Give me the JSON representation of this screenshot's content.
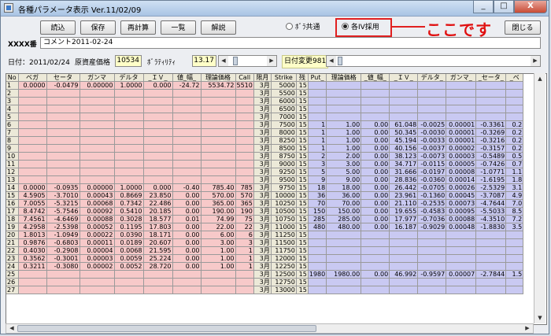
{
  "window": {
    "title": "各種パラメータ表示 Ver.11/02/09",
    "minimize": "_",
    "maximize": "□",
    "close": "X"
  },
  "toolbar": {
    "load": "読込",
    "save": "保存",
    "recalc": "再計算",
    "list": "一覧",
    "explain": "解説",
    "close": "閉じる"
  },
  "iv_mode": {
    "common_label": "ﾎﾞﾗ共通",
    "each_label": "各IV採用",
    "selected": "each"
  },
  "annotation": {
    "text": "ここです",
    "color": "#e01010"
  },
  "info": {
    "code": "XXXX番",
    "comment": "コメント2011-02-24"
  },
  "params": {
    "date_label": "日付：2011/02/24",
    "price_label": "原資産価格",
    "price_value": "10534",
    "vol_label": "ﾎﾞﾗﾃｨﾘﾃｨ",
    "vol_value": "13.17",
    "date_change_label": "日付変更981"
  },
  "colors": {
    "call_side": "#f7c9c9",
    "put_side": "#c9c9f2",
    "header": "#ece9d8",
    "yellow_field": "#ffffc8"
  },
  "grid": {
    "headers": [
      "No",
      "ベガ",
      "セータ",
      "ガンマ",
      "デルタ",
      "_ＩＶ_",
      "値_幅_",
      "理論価格",
      "Call",
      "限月",
      "Strike",
      "残",
      "Put_",
      "理論価格",
      "_値_幅_",
      "_ＩＶ_",
      "デルタ_",
      "ガンマ_",
      "_セータ_",
      "_ベ"
    ],
    "rows": [
      [
        "1",
        "0.0000",
        "-0.0479",
        "0.00000",
        "1.0000",
        "0.000",
        "-24.72",
        "5534.72",
        "5510",
        "3月",
        "5000",
        "15",
        "",
        "",
        "",
        "",
        "",
        "",
        "",
        ""
      ],
      [
        "2",
        "",
        "",
        "",
        "",
        "",
        "",
        "",
        "",
        "3月",
        "5500",
        "15",
        "",
        "",
        "",
        "",
        "",
        "",
        "",
        ""
      ],
      [
        "3",
        "",
        "",
        "",
        "",
        "",
        "",
        "",
        "",
        "3月",
        "6000",
        "15",
        "",
        "",
        "",
        "",
        "",
        "",
        "",
        ""
      ],
      [
        "4",
        "",
        "",
        "",
        "",
        "",
        "",
        "",
        "",
        "3月",
        "6500",
        "15",
        "",
        "",
        "",
        "",
        "",
        "",
        "",
        ""
      ],
      [
        "5",
        "",
        "",
        "",
        "",
        "",
        "",
        "",
        "",
        "3月",
        "7000",
        "15",
        "",
        "",
        "",
        "",
        "",
        "",
        "",
        ""
      ],
      [
        "6",
        "",
        "",
        "",
        "",
        "",
        "",
        "",
        "",
        "3月",
        "7500",
        "15",
        "1",
        "1.00",
        "0.00",
        "61.048",
        "-0.0025",
        "0.00001",
        "-0.3361",
        "0.2"
      ],
      [
        "7",
        "",
        "",
        "",
        "",
        "",
        "",
        "",
        "",
        "3月",
        "8000",
        "15",
        "1",
        "1.00",
        "0.00",
        "50.345",
        "-0.0030",
        "0.00001",
        "-0.3269",
        "0.2"
      ],
      [
        "8",
        "",
        "",
        "",
        "",
        "",
        "",
        "",
        "",
        "3月",
        "8250",
        "15",
        "1",
        "1.00",
        "0.00",
        "45.194",
        "-0.0033",
        "0.00001",
        "-0.3216",
        "0.2"
      ],
      [
        "9",
        "",
        "",
        "",
        "",
        "",
        "",
        "",
        "",
        "3月",
        "8500",
        "15",
        "1",
        "1.00",
        "0.00",
        "40.156",
        "-0.0037",
        "0.00002",
        "-0.3157",
        "0.2"
      ],
      [
        "10",
        "",
        "",
        "",
        "",
        "",
        "",
        "",
        "",
        "3月",
        "8750",
        "15",
        "2",
        "2.00",
        "0.00",
        "38.123",
        "-0.0073",
        "0.00003",
        "-0.5489",
        "0.5"
      ],
      [
        "11",
        "",
        "",
        "",
        "",
        "",
        "",
        "",
        "",
        "3月",
        "9000",
        "15",
        "3",
        "3.00",
        "0.00",
        "34.717",
        "-0.0115",
        "0.00005",
        "-0.7426",
        "0.7"
      ],
      [
        "12",
        "",
        "",
        "",
        "",
        "",
        "",
        "",
        "",
        "3月",
        "9250",
        "15",
        "5",
        "5.00",
        "0.00",
        "31.666",
        "-0.0197",
        "0.00008",
        "-1.0771",
        "1.1"
      ],
      [
        "13",
        "",
        "",
        "",
        "",
        "",
        "",
        "",
        "",
        "3月",
        "9500",
        "15",
        "9",
        "9.00",
        "0.00",
        "28.836",
        "-0.0360",
        "0.00014",
        "-1.6195",
        "1.8"
      ],
      [
        "14",
        "0.0000",
        "-0.0935",
        "0.00000",
        "1.0000",
        "0.000",
        "-0.40",
        "785.40",
        "785",
        "3月",
        "9750",
        "15",
        "18",
        "18.00",
        "0.00",
        "26.442",
        "-0.0705",
        "0.00026",
        "-2.5329",
        "3.1"
      ],
      [
        "15",
        "4.5905",
        "-3.7010",
        "0.00043",
        "0.8669",
        "23.850",
        "0.00",
        "570.00",
        "570",
        "3月",
        "10000",
        "15",
        "36",
        "36.00",
        "0.00",
        "23.961",
        "-0.1360",
        "0.00045",
        "-3.7087",
        "4.9"
      ],
      [
        "16",
        "7.0055",
        "-5.3215",
        "0.00068",
        "0.7342",
        "22.486",
        "0.00",
        "365.00",
        "365",
        "3月",
        "10250",
        "15",
        "70",
        "70.00",
        "0.00",
        "21.110",
        "-0.2535",
        "0.00073",
        "-4.7644",
        "7.0"
      ],
      [
        "17",
        "8.4742",
        "-5.7546",
        "0.00092",
        "0.5410",
        "20.185",
        "0.00",
        "190.00",
        "190",
        "3月",
        "10500",
        "15",
        "150",
        "150.00",
        "0.00",
        "19.655",
        "-0.4583",
        "0.00095",
        "-5.5033",
        "8.5"
      ],
      [
        "18",
        "7.4561",
        "-4.6469",
        "0.00088",
        "0.3028",
        "18.577",
        "0.01",
        "74.99",
        "75",
        "3月",
        "10750",
        "15",
        "285",
        "285.00",
        "0.00",
        "17.977",
        "-0.7036",
        "0.00088",
        "-4.3510",
        "7.2"
      ],
      [
        "19",
        "4.2958",
        "-2.5398",
        "0.00052",
        "0.1195",
        "17.803",
        "0.00",
        "22.00",
        "22",
        "3月",
        "11000",
        "15",
        "480",
        "480.00",
        "0.00",
        "16.187",
        "-0.9029",
        "0.00048",
        "-1.8830",
        "3.5"
      ],
      [
        "20",
        "1.8013",
        "-1.0949",
        "0.00022",
        "0.0390",
        "18.171",
        "0.00",
        "6.00",
        "6",
        "3月",
        "11250",
        "15",
        "",
        "",
        "",
        "",
        "",
        "",
        "",
        ""
      ],
      [
        "21",
        "0.9876",
        "-0.6803",
        "0.00011",
        "0.0189",
        "20.607",
        "0.00",
        "3.00",
        "3",
        "3月",
        "11500",
        "15",
        "",
        "",
        "",
        "",
        "",
        "",
        "",
        ""
      ],
      [
        "22",
        "0.4030",
        "-0.2908",
        "0.00004",
        "0.0068",
        "21.595",
        "0.00",
        "1.00",
        "1",
        "3月",
        "11750",
        "15",
        "",
        "",
        "",
        "",
        "",
        "",
        "",
        ""
      ],
      [
        "23",
        "0.3562",
        "-0.3001",
        "0.00003",
        "0.0059",
        "25.224",
        "0.00",
        "1.00",
        "1",
        "3月",
        "12000",
        "15",
        "",
        "",
        "",
        "",
        "",
        "",
        "",
        ""
      ],
      [
        "24",
        "0.3211",
        "-0.3080",
        "0.00002",
        "0.0052",
        "28.720",
        "0.00",
        "1.00",
        "1",
        "3月",
        "12250",
        "15",
        "",
        "",
        "",
        "",
        "",
        "",
        "",
        ""
      ],
      [
        "25",
        "",
        "",
        "",
        "",
        "",
        "",
        "",
        "",
        "3月",
        "12500",
        "15",
        "1980",
        "1980.00",
        "0.00",
        "46.992",
        "-0.9597",
        "0.00007",
        "-2.7844",
        "1.5"
      ],
      [
        "26",
        "",
        "",
        "",
        "",
        "",
        "",
        "",
        "",
        "3月",
        "12750",
        "15",
        "",
        "",
        "",
        "",
        "",
        "",
        "",
        ""
      ],
      [
        "27",
        "",
        "",
        "",
        "",
        "",
        "",
        "",
        "",
        "3月",
        "13000",
        "15",
        "",
        "",
        "",
        "",
        "",
        "",
        "",
        ""
      ]
    ]
  }
}
